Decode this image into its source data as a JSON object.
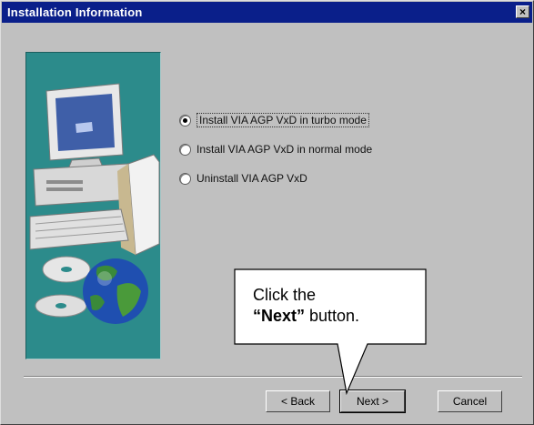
{
  "window": {
    "title": "Installation Information",
    "close_glyph": "×"
  },
  "illustration": {
    "description_icon": "computer-and-globe-icon"
  },
  "options": [
    {
      "label": "Install VIA AGP VxD in turbo mode",
      "checked": true
    },
    {
      "label": "Install VIA AGP VxD in normal mode",
      "checked": false
    },
    {
      "label": "Uninstall VIA AGP VxD",
      "checked": false
    }
  ],
  "buttons": {
    "back": "< Back",
    "next": "Next >",
    "cancel": "Cancel"
  },
  "callout": {
    "line1": "Click the",
    "bold": "“Next”",
    "rest": " button."
  },
  "colors": {
    "titlebar": "#0a1f8a",
    "panel": "#2c8b8b",
    "dialog": "#c0c0c0"
  }
}
